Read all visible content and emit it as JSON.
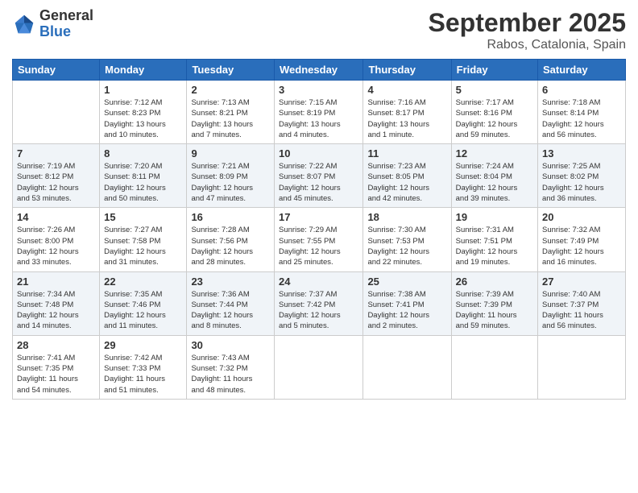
{
  "app": {
    "logo_general": "General",
    "logo_blue": "Blue"
  },
  "header": {
    "month": "September 2025",
    "location": "Rabos, Catalonia, Spain"
  },
  "weekdays": [
    "Sunday",
    "Monday",
    "Tuesday",
    "Wednesday",
    "Thursday",
    "Friday",
    "Saturday"
  ],
  "weeks": [
    [
      {
        "day": "",
        "info": ""
      },
      {
        "day": "1",
        "info": "Sunrise: 7:12 AM\nSunset: 8:23 PM\nDaylight: 13 hours\nand 10 minutes."
      },
      {
        "day": "2",
        "info": "Sunrise: 7:13 AM\nSunset: 8:21 PM\nDaylight: 13 hours\nand 7 minutes."
      },
      {
        "day": "3",
        "info": "Sunrise: 7:15 AM\nSunset: 8:19 PM\nDaylight: 13 hours\nand 4 minutes."
      },
      {
        "day": "4",
        "info": "Sunrise: 7:16 AM\nSunset: 8:17 PM\nDaylight: 13 hours\nand 1 minute."
      },
      {
        "day": "5",
        "info": "Sunrise: 7:17 AM\nSunset: 8:16 PM\nDaylight: 12 hours\nand 59 minutes."
      },
      {
        "day": "6",
        "info": "Sunrise: 7:18 AM\nSunset: 8:14 PM\nDaylight: 12 hours\nand 56 minutes."
      }
    ],
    [
      {
        "day": "7",
        "info": "Sunrise: 7:19 AM\nSunset: 8:12 PM\nDaylight: 12 hours\nand 53 minutes."
      },
      {
        "day": "8",
        "info": "Sunrise: 7:20 AM\nSunset: 8:11 PM\nDaylight: 12 hours\nand 50 minutes."
      },
      {
        "day": "9",
        "info": "Sunrise: 7:21 AM\nSunset: 8:09 PM\nDaylight: 12 hours\nand 47 minutes."
      },
      {
        "day": "10",
        "info": "Sunrise: 7:22 AM\nSunset: 8:07 PM\nDaylight: 12 hours\nand 45 minutes."
      },
      {
        "day": "11",
        "info": "Sunrise: 7:23 AM\nSunset: 8:05 PM\nDaylight: 12 hours\nand 42 minutes."
      },
      {
        "day": "12",
        "info": "Sunrise: 7:24 AM\nSunset: 8:04 PM\nDaylight: 12 hours\nand 39 minutes."
      },
      {
        "day": "13",
        "info": "Sunrise: 7:25 AM\nSunset: 8:02 PM\nDaylight: 12 hours\nand 36 minutes."
      }
    ],
    [
      {
        "day": "14",
        "info": "Sunrise: 7:26 AM\nSunset: 8:00 PM\nDaylight: 12 hours\nand 33 minutes."
      },
      {
        "day": "15",
        "info": "Sunrise: 7:27 AM\nSunset: 7:58 PM\nDaylight: 12 hours\nand 31 minutes."
      },
      {
        "day": "16",
        "info": "Sunrise: 7:28 AM\nSunset: 7:56 PM\nDaylight: 12 hours\nand 28 minutes."
      },
      {
        "day": "17",
        "info": "Sunrise: 7:29 AM\nSunset: 7:55 PM\nDaylight: 12 hours\nand 25 minutes."
      },
      {
        "day": "18",
        "info": "Sunrise: 7:30 AM\nSunset: 7:53 PM\nDaylight: 12 hours\nand 22 minutes."
      },
      {
        "day": "19",
        "info": "Sunrise: 7:31 AM\nSunset: 7:51 PM\nDaylight: 12 hours\nand 19 minutes."
      },
      {
        "day": "20",
        "info": "Sunrise: 7:32 AM\nSunset: 7:49 PM\nDaylight: 12 hours\nand 16 minutes."
      }
    ],
    [
      {
        "day": "21",
        "info": "Sunrise: 7:34 AM\nSunset: 7:48 PM\nDaylight: 12 hours\nand 14 minutes."
      },
      {
        "day": "22",
        "info": "Sunrise: 7:35 AM\nSunset: 7:46 PM\nDaylight: 12 hours\nand 11 minutes."
      },
      {
        "day": "23",
        "info": "Sunrise: 7:36 AM\nSunset: 7:44 PM\nDaylight: 12 hours\nand 8 minutes."
      },
      {
        "day": "24",
        "info": "Sunrise: 7:37 AM\nSunset: 7:42 PM\nDaylight: 12 hours\nand 5 minutes."
      },
      {
        "day": "25",
        "info": "Sunrise: 7:38 AM\nSunset: 7:41 PM\nDaylight: 12 hours\nand 2 minutes."
      },
      {
        "day": "26",
        "info": "Sunrise: 7:39 AM\nSunset: 7:39 PM\nDaylight: 11 hours\nand 59 minutes."
      },
      {
        "day": "27",
        "info": "Sunrise: 7:40 AM\nSunset: 7:37 PM\nDaylight: 11 hours\nand 56 minutes."
      }
    ],
    [
      {
        "day": "28",
        "info": "Sunrise: 7:41 AM\nSunset: 7:35 PM\nDaylight: 11 hours\nand 54 minutes."
      },
      {
        "day": "29",
        "info": "Sunrise: 7:42 AM\nSunset: 7:33 PM\nDaylight: 11 hours\nand 51 minutes."
      },
      {
        "day": "30",
        "info": "Sunrise: 7:43 AM\nSunset: 7:32 PM\nDaylight: 11 hours\nand 48 minutes."
      },
      {
        "day": "",
        "info": ""
      },
      {
        "day": "",
        "info": ""
      },
      {
        "day": "",
        "info": ""
      },
      {
        "day": "",
        "info": ""
      }
    ]
  ]
}
